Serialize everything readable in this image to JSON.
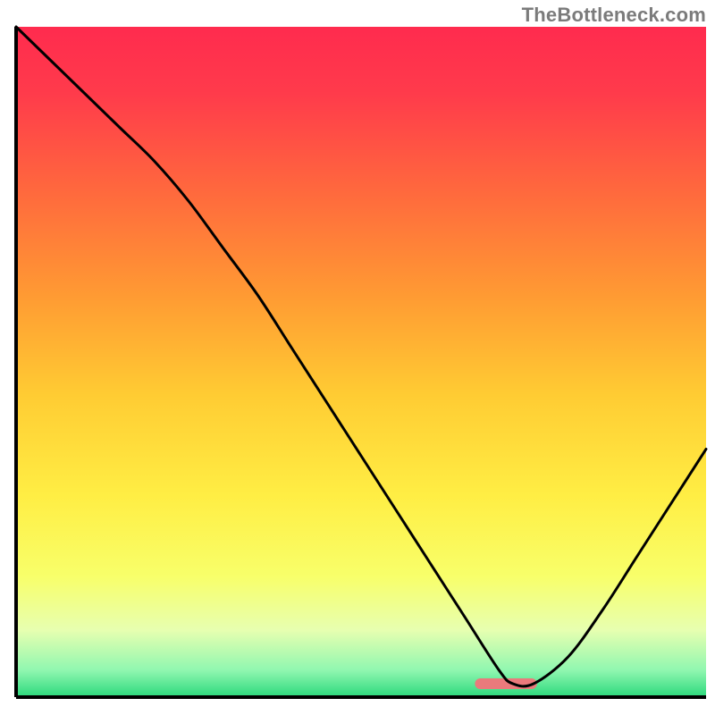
{
  "watermark": "TheBottleneck.com",
  "chart_data": {
    "type": "line",
    "title": "",
    "xlabel": "",
    "ylabel": "",
    "xlim": [
      0,
      100
    ],
    "ylim": [
      0,
      100
    ],
    "grid": false,
    "legend": false,
    "series": [
      {
        "name": "bottleneck-curve",
        "x": [
          0,
          5,
          10,
          15,
          20,
          25,
          30,
          35,
          40,
          45,
          50,
          55,
          60,
          65,
          70,
          72,
          75,
          80,
          85,
          90,
          95,
          100
        ],
        "values": [
          100,
          95,
          90,
          85,
          80,
          74,
          67,
          60,
          52,
          44,
          36,
          28,
          20,
          12,
          4,
          2,
          2,
          6,
          13,
          21,
          29,
          37
        ]
      }
    ],
    "marker": {
      "name": "optimal-range-bar",
      "x_center": 71,
      "width": 9,
      "y": 2,
      "color": "#ea7a7c"
    },
    "gradient_stops": [
      {
        "offset": 0.0,
        "color": "#ff2b4e"
      },
      {
        "offset": 0.1,
        "color": "#ff3b4b"
      },
      {
        "offset": 0.25,
        "color": "#ff6a3d"
      },
      {
        "offset": 0.4,
        "color": "#ff9a33"
      },
      {
        "offset": 0.55,
        "color": "#ffcc33"
      },
      {
        "offset": 0.7,
        "color": "#ffee44"
      },
      {
        "offset": 0.82,
        "color": "#f8ff6a"
      },
      {
        "offset": 0.9,
        "color": "#e7ffb0"
      },
      {
        "offset": 0.96,
        "color": "#90f7b0"
      },
      {
        "offset": 1.0,
        "color": "#2bd97c"
      }
    ]
  }
}
